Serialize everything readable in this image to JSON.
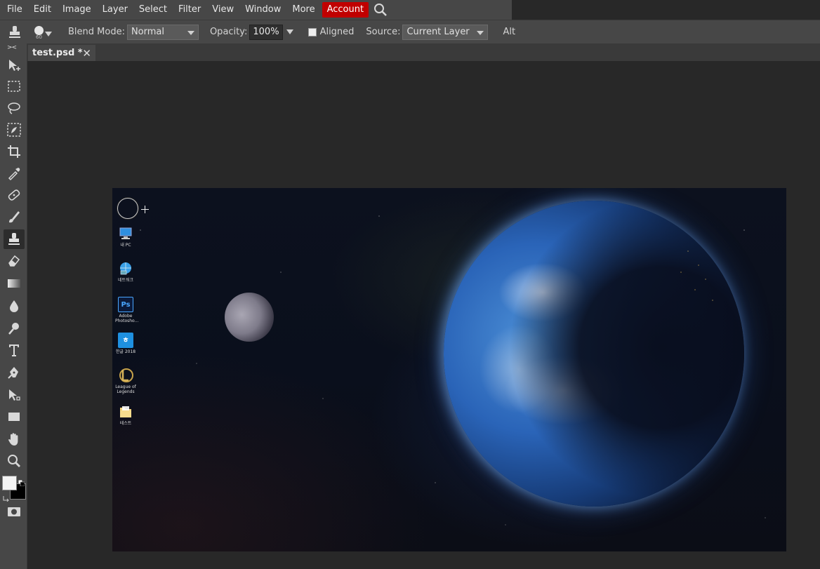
{
  "menu": {
    "items": [
      "File",
      "Edit",
      "Image",
      "Layer",
      "Select",
      "Filter",
      "View",
      "Window",
      "More"
    ],
    "account": "Account",
    "search_icon": "search-icon"
  },
  "options": {
    "brush_size": "60",
    "blend_mode_label": "Blend Mode:",
    "blend_mode_value": "Normal",
    "opacity_label": "Opacity:",
    "opacity_value": "100%",
    "aligned_label": "Aligned",
    "aligned_checked": false,
    "source_label": "Source:",
    "source_value": "Current Layer",
    "alt_label": "Alt"
  },
  "toolbar": {
    "collapse": "><",
    "tools": [
      "move-tool-icon",
      "marquee-tool-icon",
      "lasso-tool-icon",
      "magic-wand-tool-icon",
      "crop-tool-icon",
      "eyedropper-tool-icon",
      "healing-tool-icon",
      "brush-tool-icon",
      "clone-stamp-tool-icon",
      "eraser-tool-icon",
      "gradient-tool-icon",
      "blur-tool-icon",
      "dodge-tool-icon",
      "type-tool-icon",
      "pen-tool-icon",
      "path-select-tool-icon",
      "rectangle-tool-icon",
      "hand-tool-icon",
      "zoom-tool-icon"
    ],
    "active_tool": "clone-stamp-tool-icon",
    "foreground_color": "#f3f3f3",
    "background_color": "#000000"
  },
  "tabs": [
    {
      "label": "test.psd *",
      "close": "✕"
    }
  ],
  "canvas": {
    "desktop_icons": [
      {
        "label": "내 PC",
        "icon": "pc-icon"
      },
      {
        "label": "네트워크",
        "icon": "network-icon"
      },
      {
        "label": "Adobe Photosho...",
        "icon": "photoshop-icon",
        "glyph": "Ps"
      },
      {
        "label": "한글 2018",
        "icon": "hangul-icon",
        "glyph": "ㅎ"
      },
      {
        "label": "League of Legends",
        "icon": "league-icon"
      },
      {
        "label": "테스트",
        "icon": "folder-icon"
      }
    ]
  }
}
